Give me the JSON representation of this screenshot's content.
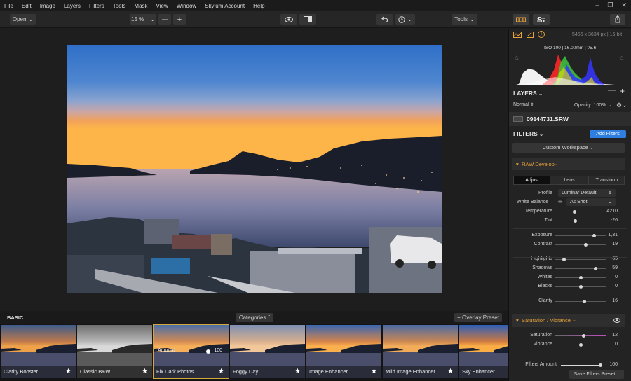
{
  "menu": [
    "File",
    "Edit",
    "Image",
    "Layers",
    "Filters",
    "Tools",
    "Mask",
    "View",
    "Window",
    "Skylum Account",
    "Help"
  ],
  "toolbar": {
    "open_label": "Open",
    "zoom_value": "15 %",
    "zoom_out": "—",
    "zoom_in": "+",
    "tools_label": "Tools"
  },
  "info": {
    "dimensions": "5456 x 3634 px | 16-bit",
    "exif": "ISO 100  |  16.00mm  |  f/5.6"
  },
  "layers": {
    "title": "LAYERS",
    "blend_mode": "Normal",
    "opacity": "Opacity: 100%",
    "layer_name": "09144731.SRW"
  },
  "filters": {
    "title": "FILTERS",
    "add_button": "Add Filters",
    "workspace": "Custom Workspace",
    "raw_title": "RAW Develop",
    "tabs": [
      "Adjust",
      "Lens",
      "Transform"
    ],
    "profile_label": "Profile",
    "profile_value": "Luminar Default",
    "wb_label": "White Balance",
    "wb_value": "As Shot",
    "sliders": [
      {
        "label": "Temperature",
        "value": "4210",
        "pos": 0.38
      },
      {
        "label": "Tint",
        "value": "-26",
        "pos": 0.4
      },
      {
        "label": "Exposure",
        "value": "1,31",
        "pos": 0.77
      },
      {
        "label": "Contrast",
        "value": "19",
        "pos": 0.6
      },
      {
        "label": "Highlights",
        "value": "-65",
        "pos": 0.18
      },
      {
        "label": "Shadows",
        "value": "59",
        "pos": 0.8
      },
      {
        "label": "Whites",
        "value": "0",
        "pos": 0.5
      },
      {
        "label": "Blacks",
        "value": "0",
        "pos": 0.5
      },
      {
        "label": "Clarity",
        "value": "16",
        "pos": 0.58
      }
    ],
    "sat_title": "Saturation / Vibrance",
    "sat_sliders": [
      {
        "label": "Saturation",
        "value": "12",
        "pos": 0.56
      },
      {
        "label": "Vibrance",
        "value": "0",
        "pos": 0.5
      }
    ],
    "amount_label": "Filters Amount",
    "amount_value": "100",
    "amount_pos": 1.0,
    "save_preset": "Save Filters Preset..."
  },
  "filmstrip": {
    "section": "BASIC",
    "categories": "Categories",
    "overlay": "+ Overlay Preset",
    "amount_label": "Amount",
    "amount_value": "100",
    "amount_pos": 1.0,
    "presets": [
      "Clarity Booster",
      "Classic B&W",
      "Fix Dark Photos",
      "Foggy Day",
      "Image Enhancer",
      "Mild Image Enhancer",
      "Sky Enhancer"
    ],
    "selected_index": 2
  },
  "colors": {
    "accent": "#2f7fe0",
    "raw_section": "#e8a23c",
    "selection": "#d4a83a"
  }
}
